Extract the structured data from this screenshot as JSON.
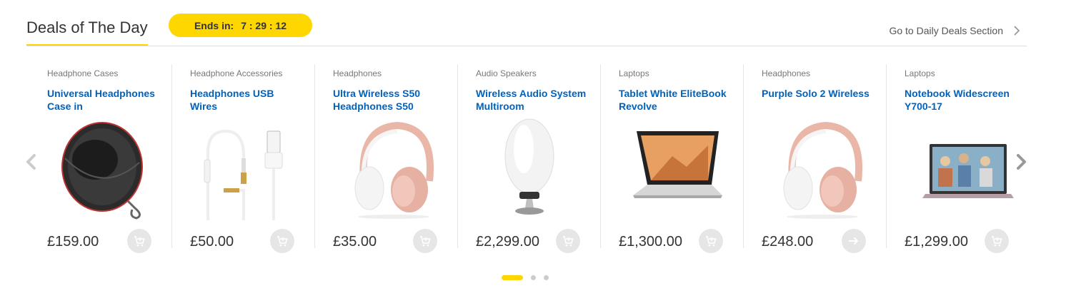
{
  "header": {
    "title": "Deals of The Day",
    "timer_prefix": "Ends in:",
    "timer_value": "7 : 29 : 12",
    "link_label": "Go to Daily Deals Section"
  },
  "colors": {
    "accent": "#fed700",
    "link": "#0062bd",
    "cart_bg": "#e6e6e6"
  },
  "products": [
    {
      "category": "Headphone Cases",
      "name": "Universal Headphones Case in",
      "price": "£159.00",
      "image": "headphone-case",
      "action_icon": "add-to-cart-icon"
    },
    {
      "category": "Headphone Accessories",
      "name": "Headphones USB Wires",
      "price": "£50.00",
      "image": "usb-wire",
      "action_icon": "add-to-cart-icon"
    },
    {
      "category": "Headphones",
      "name": "Ultra Wireless S50 Headphones S50",
      "price": "£35.00",
      "image": "pink-headphones",
      "action_icon": "add-to-cart-icon"
    },
    {
      "category": "Audio Speakers",
      "name": "Wireless Audio System Multiroom",
      "price": "£2,299.00",
      "image": "white-speaker",
      "action_icon": "add-to-cart-icon"
    },
    {
      "category": "Laptops",
      "name": "Tablet White EliteBook Revolve",
      "price": "£1,300.00",
      "image": "convertible-laptop",
      "action_icon": "add-to-cart-icon"
    },
    {
      "category": "Headphones",
      "name": "Purple Solo 2 Wireless",
      "price": "£248.00",
      "image": "pink-headphones",
      "action_icon": "arrow-right-icon"
    },
    {
      "category": "Laptops",
      "name": "Notebook Widescreen Y700-17",
      "price": "£1,299.00",
      "image": "notebook-laptop",
      "action_icon": "add-to-cart-icon"
    }
  ],
  "pagination": {
    "pages": 3,
    "active": 1
  }
}
